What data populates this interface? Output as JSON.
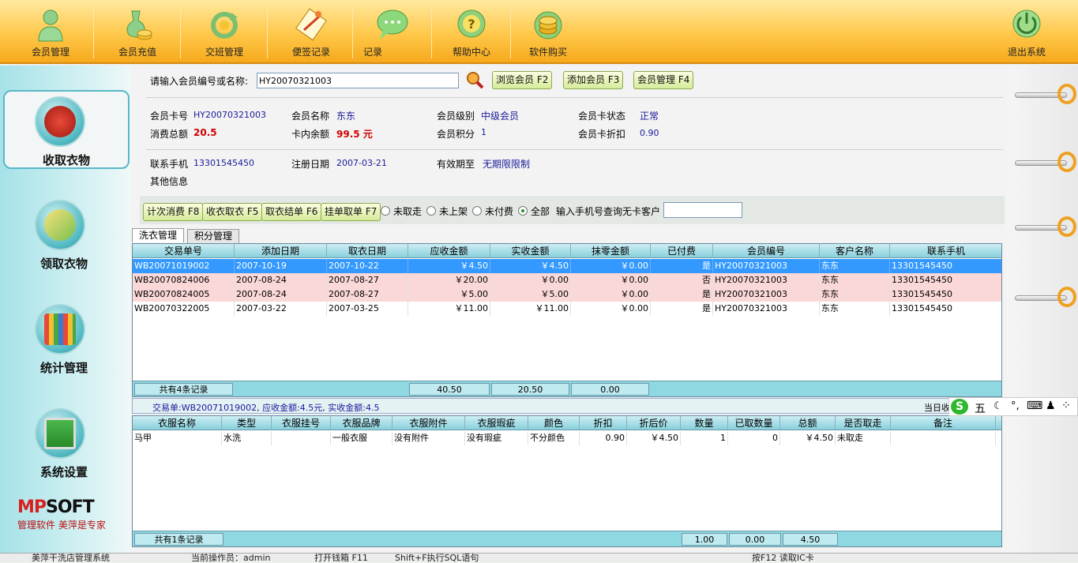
{
  "top_nav": [
    {
      "label": "会员管理",
      "icon": "member-icon"
    },
    {
      "label": "会员充值",
      "icon": "recharge-icon"
    },
    {
      "label": "交班管理",
      "icon": "shift-icon"
    },
    {
      "label": "便签记录",
      "icon": "notes-icon"
    },
    {
      "label": "记录",
      "icon": "chat-icon"
    },
    {
      "label": "帮助中心",
      "icon": "help-icon"
    },
    {
      "label": "软件购买",
      "icon": "coins-icon"
    },
    {
      "label": "退出系统",
      "icon": "power-icon"
    }
  ],
  "left_nav": [
    {
      "label": "收取衣物",
      "icon": "coat-icon",
      "active": true
    },
    {
      "label": "领取衣物",
      "icon": "bag-icon",
      "active": false
    },
    {
      "label": "统计管理",
      "icon": "stats-icon",
      "active": false
    },
    {
      "label": "系统设置",
      "icon": "monitor-icon",
      "active": false
    }
  ],
  "logo": {
    "brand_a": "MP",
    "brand_b": "SOFT",
    "slogan": "管理软件 美萍是专家"
  },
  "search": {
    "label": "请输入会员编号或名称:",
    "value": "HY20070321003",
    "btn_browse": "浏览会员 F2",
    "btn_add": "添加会员 F3",
    "btn_manage": "会员管理 F4"
  },
  "member": {
    "card_no_label": "会员卡号",
    "card_no": "HY20070321003",
    "name_label": "会员名称",
    "name": "东东",
    "level_label": "会员级别",
    "level": "中级会员",
    "status_label": "会员卡状态",
    "status": "正常",
    "total_label": "消费总额",
    "total": "20.5",
    "balance_label": "卡内余额",
    "balance": "99.5 元",
    "points_label": "会员积分",
    "points": "1",
    "discount_label": "会员卡折扣",
    "discount": "0.90",
    "phone_label": "联系手机",
    "phone": "13301545450",
    "regdate_label": "注册日期",
    "regdate": "2007-03-21",
    "expire_label": "有效期至",
    "expire": "无期限限制",
    "other_label": "其他信息"
  },
  "actions": {
    "count_btn": "计次消费 F8",
    "collect_btn": "收衣取衣 F5",
    "checkout_btn": "取衣结单 F6",
    "hang_btn": "挂单取单 F7",
    "radios": [
      {
        "label": "未取走",
        "on": false
      },
      {
        "label": "未上架",
        "on": false
      },
      {
        "label": "未付费",
        "on": false
      },
      {
        "label": "全部",
        "on": true
      }
    ],
    "phone_query_label": "输入手机号查询无卡客户",
    "phone_query_value": ""
  },
  "tabs": [
    {
      "label": "洗衣管理",
      "on": true
    },
    {
      "label": "积分管理",
      "on": false
    }
  ],
  "orders": {
    "headers": [
      "交易单号",
      "添加日期",
      "取衣日期",
      "应收金额",
      "实收金额",
      "抹零金额",
      "已付费",
      "会员编号",
      "客户名称",
      "联系手机"
    ],
    "rows": [
      [
        "WB20071019002",
        "2007-10-19",
        "2007-10-22",
        "￥4.50",
        "￥4.50",
        "￥0.00",
        "是",
        "HY20070321003",
        "东东",
        "13301545450"
      ],
      [
        "WB20070824006",
        "2007-08-24",
        "2007-08-27",
        "￥20.00",
        "￥0.00",
        "￥0.00",
        "否",
        "HY20070321003",
        "东东",
        "13301545450"
      ],
      [
        "WB20070824005",
        "2007-08-24",
        "2007-08-27",
        "￥5.00",
        "￥5.00",
        "￥0.00",
        "是",
        "HY20070321003",
        "东东",
        "13301545450"
      ],
      [
        "WB20070322005",
        "2007-03-22",
        "2007-03-25",
        "￥11.00",
        "￥11.00",
        "￥0.00",
        "是",
        "HY20070321003",
        "东东",
        "13301545450"
      ]
    ],
    "footer_count": "共有4条记录",
    "footer_due": "40.50",
    "footer_paid": "20.50",
    "footer_round": "0.00"
  },
  "order_summary": "交易单:WB20071019002, 应收金额:4.5元, 实收金额:4.5",
  "order_right_label": "当日收",
  "items": {
    "headers": [
      "衣服名称",
      "类型",
      "衣服挂号",
      "衣服品牌",
      "衣服附件",
      "衣服瑕疵",
      "颜色",
      "折扣",
      "折后价",
      "数量",
      "已取数量",
      "总额",
      "是否取走",
      "备注"
    ],
    "rows": [
      [
        "马甲",
        "水洗",
        "",
        "一般衣服",
        "没有附件",
        "没有瑕疵",
        "不分颜色",
        "0.90",
        "￥4.50",
        "1",
        "0",
        "￥4.50",
        "未取走",
        ""
      ]
    ],
    "footer_count": "共有1条记录",
    "footer_qty": "1.00",
    "footer_taken": "0.00",
    "footer_total": "4.50"
  },
  "ime": {
    "labels": [
      "五",
      "☾",
      "°,",
      "⌨",
      "♟",
      "⁘"
    ]
  },
  "status_bar": [
    "美萍干洗店管理系统",
    "当前操作员：admin",
    "打开钱箱 F11",
    "Shift+F执行SQL语句",
    "按F12 读取IC卡"
  ]
}
